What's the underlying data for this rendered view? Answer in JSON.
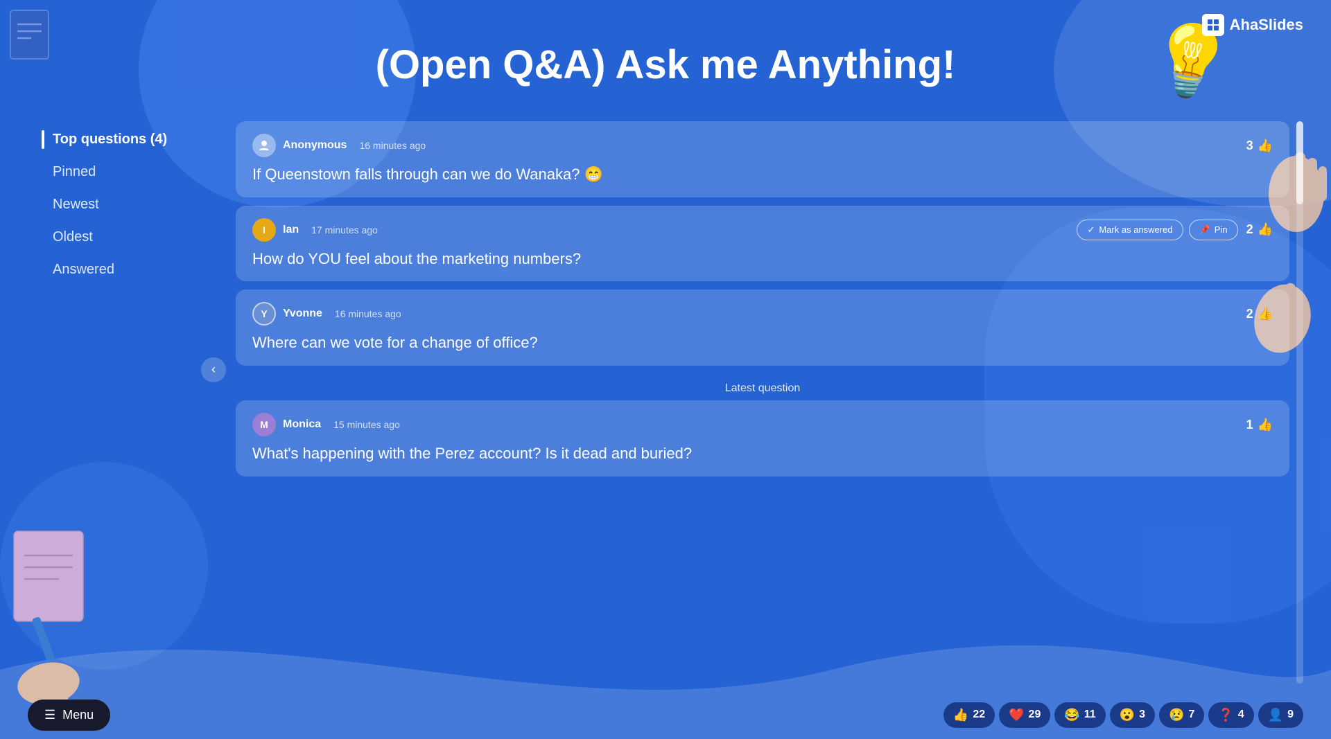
{
  "app": {
    "logo_text": "AhaSlides",
    "title": "(Open Q&A) Ask me Anything!"
  },
  "sidebar": {
    "items": [
      {
        "id": "top-questions",
        "label": "Top questions",
        "badge": "(4)",
        "active": true
      },
      {
        "id": "pinned",
        "label": "Pinned",
        "active": false
      },
      {
        "id": "newest",
        "label": "Newest",
        "active": false
      },
      {
        "id": "oldest",
        "label": "Oldest",
        "active": false
      },
      {
        "id": "answered",
        "label": "Answered",
        "active": false
      }
    ]
  },
  "questions": [
    {
      "id": "q1",
      "author": "Anonymous",
      "avatar_letter": "👤",
      "avatar_type": "gray",
      "time_ago": "16 minutes ago",
      "text": "If Queenstown falls through can we do Wanaka? 😁",
      "likes": 3,
      "show_actions": false
    },
    {
      "id": "q2",
      "author": "Ian",
      "avatar_letter": "I",
      "avatar_type": "yellow",
      "time_ago": "17 minutes ago",
      "text": "How do YOU feel about the marketing numbers?",
      "likes": 2,
      "show_actions": true,
      "btn_mark": "Mark as answered",
      "btn_pin": "Pin"
    },
    {
      "id": "q3",
      "author": "Yvonne",
      "avatar_letter": "Y",
      "avatar_type": "blue",
      "time_ago": "16 minutes ago",
      "text": "Where can we vote for a change of office?",
      "likes": 2,
      "show_actions": false
    }
  ],
  "latest_question": {
    "label": "Latest question",
    "author": "Monica",
    "avatar_letter": "M",
    "avatar_type": "purple",
    "time_ago": "15 minutes ago",
    "text": "What's happening with the Perez account? Is it dead and buried?",
    "likes": 1
  },
  "bottom_bar": {
    "menu_label": "Menu",
    "reactions": [
      {
        "emoji": "👍",
        "count": "22"
      },
      {
        "emoji": "❤️",
        "count": "29"
      },
      {
        "emoji": "😂",
        "count": "11"
      },
      {
        "emoji": "😮",
        "count": "3"
      },
      {
        "emoji": "😢",
        "count": "7"
      },
      {
        "emoji": "❓",
        "count": "4"
      },
      {
        "emoji": "👤",
        "count": "9"
      }
    ]
  }
}
